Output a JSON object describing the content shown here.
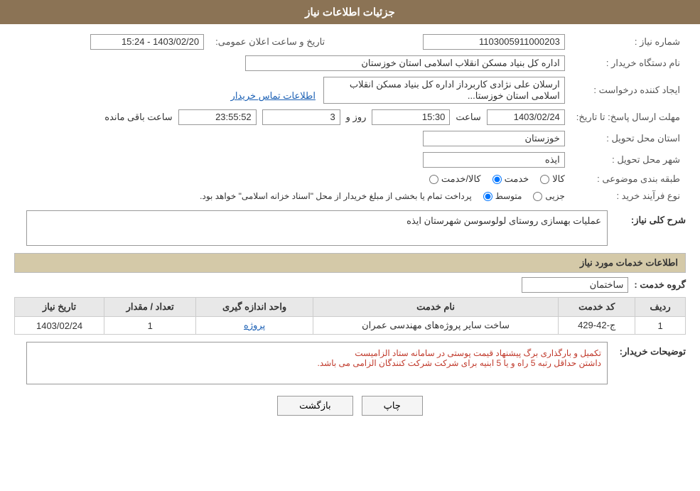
{
  "header": {
    "title": "جزئیات اطلاعات نیاز"
  },
  "fields": {
    "request_number_label": "شماره نیاز :",
    "request_number_value": "1103005911000203",
    "buyer_org_label": "نام دستگاه خریدار :",
    "buyer_org_value": "اداره کل بنیاد مسکن انقلاب اسلامی استان خوزستان",
    "created_by_label": "ایجاد کننده درخواست :",
    "created_by_value": "ارسلان علی نژادی کاربرداز اداره کل بنیاد مسکن انقلاب اسلامی استان خوزستا...",
    "created_by_link": "اطلاعات تماس خریدار",
    "response_deadline_label": "مهلت ارسال پاسخ: تا تاریخ:",
    "date_value": "1403/02/24",
    "time_value": "15:30",
    "days_value": "3",
    "remaining_value": "23:55:52",
    "province_label": "استان محل تحویل :",
    "province_value": "خوزستان",
    "city_label": "شهر محل تحویل :",
    "city_value": "ایذه",
    "category_label": "طبقه بندی موضوعی :",
    "category_radio_items": [
      "کالا",
      "خدمت",
      "کالا/خدمت"
    ],
    "category_selected": "خدمت",
    "purchase_type_label": "نوع فرآیند خرید :",
    "purchase_type_items": [
      "جزیی",
      "متوسط"
    ],
    "purchase_type_description": "پرداخت تمام یا بخشی از مبلغ خریدار از محل \"اسناد خزانه اسلامی\" خواهد بود.",
    "announce_date_label": "تاریخ و ساعت اعلان عمومی:",
    "announce_date_value": "1403/02/20 - 15:24",
    "description_label": "شرح کلی نیاز:",
    "description_value": "عملیات بهسازی روستای لولوسوسن شهرستان ایذه",
    "services_section_label": "اطلاعات خدمات مورد نیاز",
    "service_group_label": "گروه خدمت :",
    "service_group_value": "ساختمان",
    "table_headers": [
      "ردیف",
      "کد خدمت",
      "نام خدمت",
      "واحد اندازه گیری",
      "تعداد / مقدار",
      "تاریخ نیاز"
    ],
    "table_rows": [
      {
        "row": "1",
        "code": "ج-42-429",
        "name": "ساخت سایر پروژه‌های مهندسی عمران",
        "unit": "پروژه",
        "count": "1",
        "date": "1403/02/24"
      }
    ],
    "buyer_notes_label": "توضیحات خریدار:",
    "buyer_notes_value": "تکمیل و بارگذاری برگ پیشنهاد قیمت پوستی در سامانه ستاد الزامیست\nداشتن حداقل رتبه 5 راه و یا 5 ابنیه برای شرکت شرکت کنندگان الزامی می باشد."
  },
  "buttons": {
    "print_label": "چاپ",
    "back_label": "بازگشت"
  }
}
